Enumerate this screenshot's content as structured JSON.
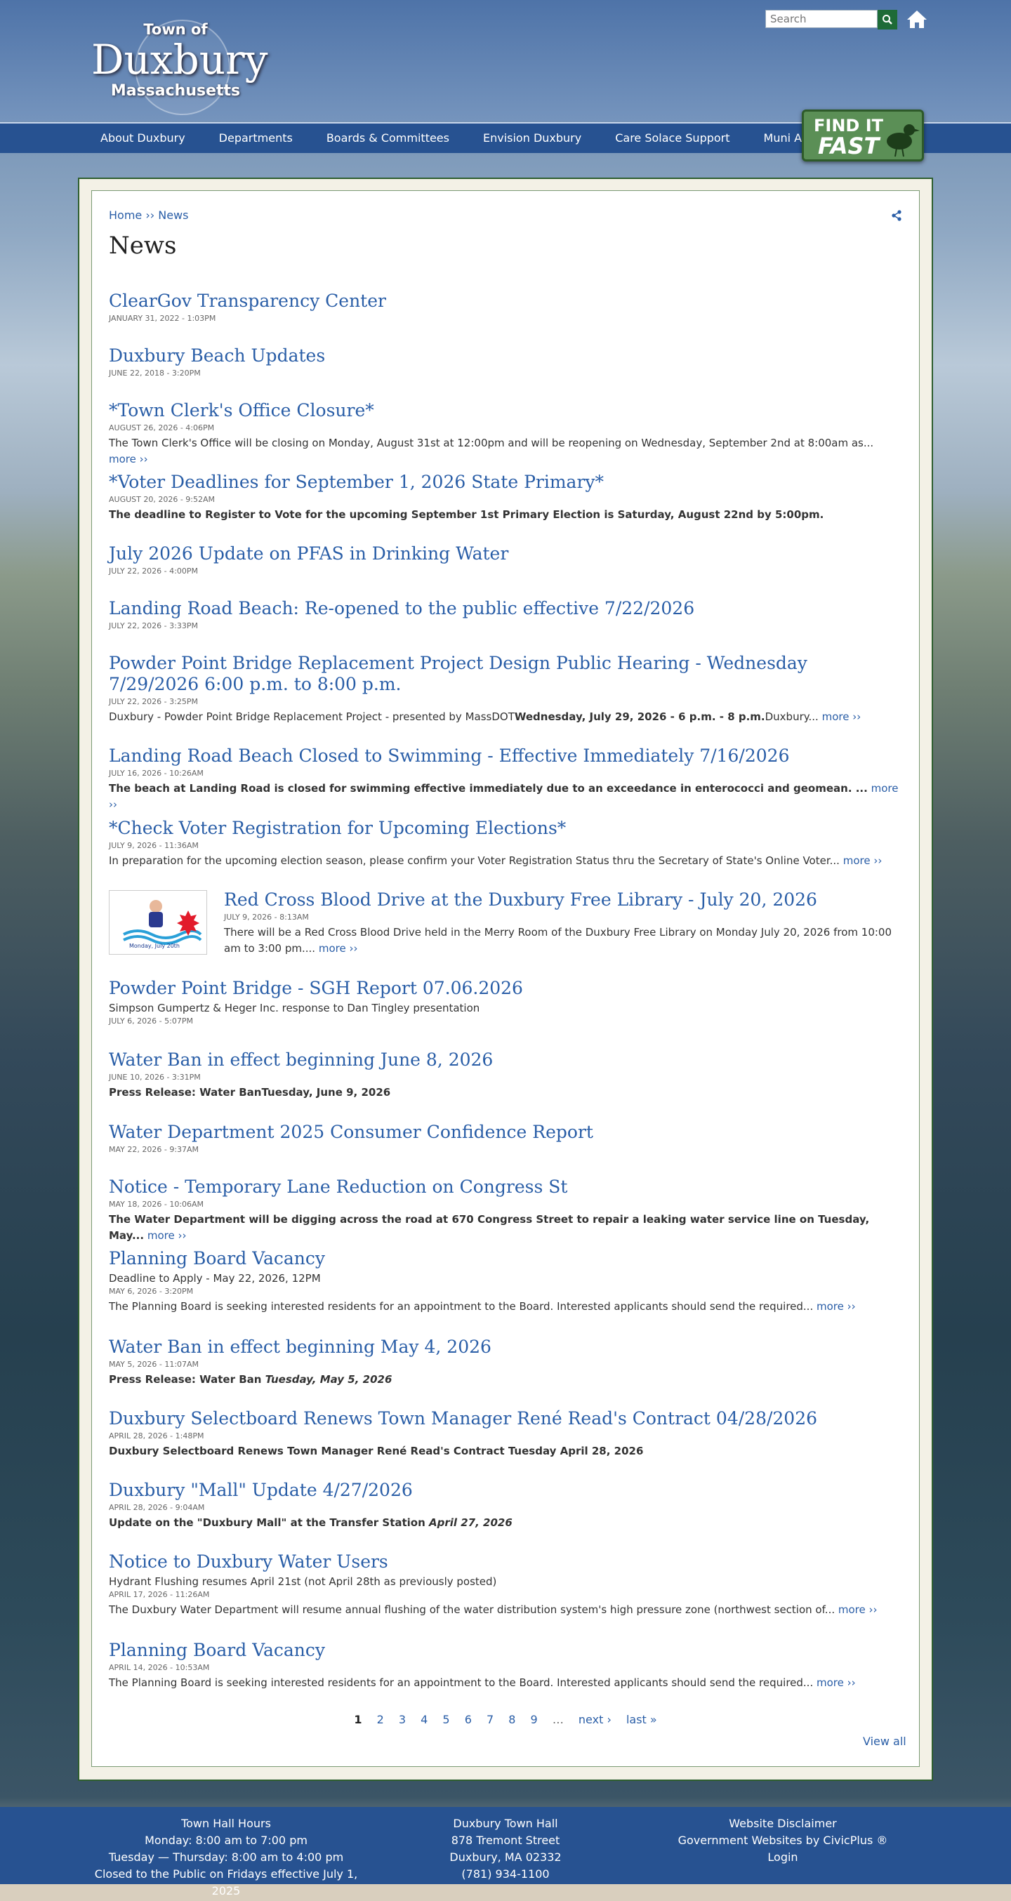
{
  "header": {
    "logo_top": "Town of",
    "logo_main": "Duxbury",
    "logo_sub": "Massachusetts",
    "search_placeholder": "Search",
    "nav": [
      "About Duxbury",
      "Departments",
      "Boards & Committees",
      "Envision Duxbury",
      "Care Solace Support",
      "Muni Aggregation"
    ],
    "findit_line1": "FIND IT",
    "findit_line2": "FAST"
  },
  "breadcrumb": {
    "home": "Home",
    "sep": " ›› ",
    "current": "News"
  },
  "page_title": "News",
  "items": [
    {
      "title": "ClearGov Transparency Center",
      "date": "January 31, 2022 - 1:03pm"
    },
    {
      "title": "Duxbury Beach Updates",
      "date": "June 22, 2018 - 3:20pm"
    },
    {
      "title": "*Town Clerk's Office Closure*",
      "date": "August 26, 2026 - 4:06pm",
      "desc": "The Town Clerk's Office will be closing on Monday, August 31st at 12:00pm and will be reopening on Wednesday, September 2nd at 8:00am as...",
      "more": "more ››"
    },
    {
      "title": "*Voter Deadlines for September 1, 2026 State Primary*",
      "date": "August 20, 2026 - 9:52am",
      "desc": "The deadline to Register to Vote for the upcoming September 1st Primary Election is Saturday, August 22nd by 5:00pm."
    },
    {
      "title": "July 2026 Update on PFAS in Drinking Water",
      "date": "July 22, 2026 - 4:00pm"
    },
    {
      "title": "Landing Road Beach: Re-opened to the public effective 7/22/2026",
      "date": "July 22, 2026 - 3:33pm"
    },
    {
      "title": "Powder Point Bridge Replacement Project Design Public Hearing - Wednesday 7/29/2026 6:00 p.m. to 8:00 p.m.",
      "date": "July 22, 2026 - 3:25pm",
      "desc_a": "Duxbury - Powder Point Bridge Replacement Project - presented by MassDOT",
      "desc_b": "Wednesday, July 29, 2026 - 6 p.m. - 8 p.m.",
      "desc_c": "Duxbury...",
      "more": "more ››"
    },
    {
      "title": "Landing Road Beach Closed to Swimming - Effective Immediately 7/16/2026",
      "date": "July 16, 2026 - 10:26am",
      "desc": "The beach at Landing Road is closed for swimming effective immediately due to an exceedance in enterococci and geomean. ...",
      "more": "more ››"
    },
    {
      "title": "*Check Voter Registration for Upcoming Elections*",
      "date": "July 9, 2026 - 11:36am",
      "desc": "In preparation for the upcoming election season, please confirm your Voter Registration Status thru the Secretary of State's Online Voter...",
      "more": "more ››"
    },
    {
      "title": "Red Cross Blood Drive at the Duxbury Free Library - July 20, 2026",
      "date": "July 9, 2026 - 8:13am",
      "desc": "There will be a Red Cross Blood Drive held in the Merry Room of the Duxbury Free Library on Monday July 20, 2026 from 10:00 am to 3:00 pm....",
      "more": "more ››",
      "thumb_caption": "Monday, July 20th"
    },
    {
      "title": "Powder Point Bridge - SGH Report 07.06.2026",
      "sub": "Simpson Gumpertz & Heger Inc. response to Dan Tingley presentation",
      "date": "July 6, 2026 - 5:07pm"
    },
    {
      "title": "Water Ban in effect beginning June 8, 2026",
      "date": "June 10, 2026 - 3:31pm",
      "desc": "Press Release: Water BanTuesday, June 9, 2026"
    },
    {
      "title": "Water Department 2025 Consumer Confidence Report",
      "date": "May 22, 2026 - 9:37am"
    },
    {
      "title": "Notice - Temporary Lane Reduction on Congress St",
      "date": "May 18, 2026 - 10:06am",
      "desc": "The Water Department will be digging across the road at 670 Congress Street to repair a leaking water service line on Tuesday, May...",
      "more": "more ››"
    },
    {
      "title": "Planning Board Vacancy",
      "sub": "Deadline to Apply - May 22, 2026, 12PM",
      "date": "May 6, 2026 - 3:20pm",
      "desc": "The Planning Board is seeking interested residents for an appointment to the Board. Interested applicants should send the required...",
      "more": "more ››"
    },
    {
      "title": "Water Ban in effect beginning May 4, 2026",
      "date": "May 5, 2026 - 11:07am",
      "desc_a": "Press Release: Water Ban ",
      "desc_b": "Tuesday, May 5, 2026"
    },
    {
      "title": "Duxbury Selectboard Renews Town Manager René Read's Contract 04/28/2026",
      "date": "April 28, 2026 - 1:48pm",
      "desc": "Duxbury Selectboard Renews Town Manager René Read's Contract Tuesday April 28, 2026"
    },
    {
      "title": "Duxbury \"Mall\" Update 4/27/2026",
      "date": "April 28, 2026 - 9:04am",
      "desc_a": "Update on the \"Duxbury Mall\" at the Transfer Station ",
      "desc_b": "April 27, 2026"
    },
    {
      "title": "Notice to Duxbury Water Users",
      "sub": "Hydrant Flushing resumes April 21st (not April 28th as previously posted)",
      "date": "April 17, 2026 - 11:26am",
      "desc": "The Duxbury Water Department will resume annual flushing of the water distribution system's high pressure zone (northwest section of...",
      "more": "more ››"
    },
    {
      "title": "Planning Board Vacancy",
      "date": "April 14, 2026 - 10:53am",
      "desc": "The Planning Board is seeking interested residents for an appointment to the Board. Interested applicants should send the required...",
      "more": "more ››"
    }
  ],
  "pager": {
    "pages": [
      "1",
      "2",
      "3",
      "4",
      "5",
      "6",
      "7",
      "8",
      "9"
    ],
    "ellipsis": "…",
    "next": "next ›",
    "last": "last »",
    "current": "1"
  },
  "view_all": "View all",
  "footer": {
    "hours": [
      "Town Hall Hours",
      "Monday:  8:00 am to 7:00 pm",
      "Tuesday — Thursday:  8:00 am to 4:00 pm",
      "Closed to the Public on Fridays effective July 1, 2025"
    ],
    "address": [
      "Duxbury Town Hall",
      "878 Tremont Street",
      "Duxbury, MA 02332",
      "(781) 934-1100"
    ],
    "links": [
      "Website Disclaimer",
      "Government Websites by CivicPlus ®",
      "Login"
    ]
  },
  "colors": {
    "link": "#2a5ea7",
    "nav_bar": "#275291",
    "findit_green": "#5b8f56",
    "card_border": "#2e5e2e"
  },
  "icons": [
    "search-icon",
    "home-icon",
    "share-icon"
  ]
}
